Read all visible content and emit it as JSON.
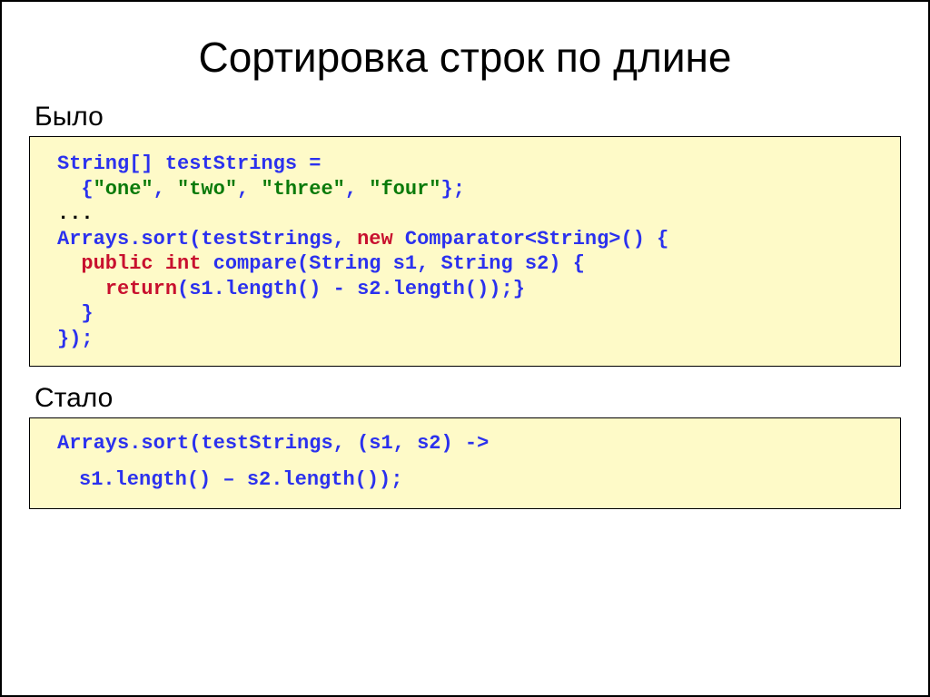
{
  "title": "Сортировка строк по длине",
  "labels": {
    "before": "Было",
    "after": "Стало"
  },
  "before": {
    "l1a": "String[] testStrings =",
    "l2a": "  {",
    "l2b": "\"one\"",
    "l2c": ", ",
    "l2d": "\"two\"",
    "l2e": ", ",
    "l2f": "\"three\"",
    "l2g": ", ",
    "l2h": "\"four\"",
    "l2i": "};",
    "l3a": "...",
    "l4a": "Arrays.sort(testStrings, ",
    "l4b": "new",
    "l4c": " Comparator<String>() {",
    "l5a": "  ",
    "l5b": "public int",
    "l5c": " compare(String s1, String s2) {",
    "l6a": "    ",
    "l6b": "return",
    "l6c": "(s1.length() - s2.length());}",
    "l7a": "  }",
    "l8a": "});"
  },
  "after": {
    "l1": "Arrays.sort(testStrings, (s1, s2) ->",
    "l2": "  s1.length() – s2.length());"
  }
}
